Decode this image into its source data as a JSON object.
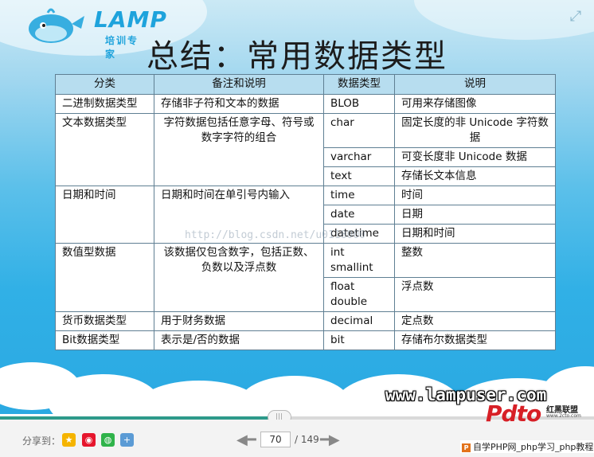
{
  "logo": {
    "word": "LAMP",
    "tagline": "培训专家"
  },
  "title": "总结：常用数据类型",
  "table": {
    "headers": [
      "分类",
      "备注和说明",
      "数据类型",
      "说明"
    ],
    "groups": [
      {
        "category": "二进制数据类型",
        "note": "存储非子符和文本的数据",
        "rows": [
          {
            "type": "BLOB",
            "desc": "可用来存储图像"
          }
        ]
      },
      {
        "category": "文本数据类型",
        "note": "字符数据包括任意字母、符号或数字字符的组合",
        "rows": [
          {
            "type": "char",
            "desc": "固定长度的非 Unicode 字符数据"
          },
          {
            "type": "varchar",
            "desc": "可变长度非 Unicode 数据"
          },
          {
            "type": "text",
            "desc": "存储长文本信息"
          }
        ]
      },
      {
        "category": "日期和时间",
        "note": "日期和时间在单引号内输入",
        "rows": [
          {
            "type": "time",
            "desc": "时间"
          },
          {
            "type": "date",
            "desc": "日期"
          },
          {
            "type": "datetime",
            "desc": "日期和时间"
          }
        ]
      },
      {
        "category": "数值型数据",
        "note": "该数据仅包含数字，包括正数、负数以及浮点数",
        "rows": [
          {
            "type": "int smallint",
            "desc": "整数"
          },
          {
            "type": "float double",
            "desc": "浮点数"
          }
        ]
      },
      {
        "category": "货币数据类型",
        "note": "用于财务数据",
        "rows": [
          {
            "type": "decimal",
            "desc": "定点数"
          }
        ]
      },
      {
        "category": "Bit数据类型",
        "note": "表示是/否的数据",
        "rows": [
          {
            "type": "bit",
            "desc": "存储布尔数据类型"
          }
        ]
      }
    ]
  },
  "watermark": "http://blog.csdn.net/u0118000",
  "site_text": "www.lampuser.com",
  "viewer": {
    "progress": 0.47,
    "share_label": "分享到：",
    "share_icons": [
      "qzone-icon",
      "weibo-icon",
      "wechat-icon",
      "plus-icon"
    ],
    "current_page": "70",
    "total_pages": "/ 149"
  },
  "brand": {
    "logo": "Pdto",
    "name": "红黑联盟",
    "sub": "www.2cto.com",
    "text": "自学PHP网_php学习_php教程"
  },
  "colors": {
    "slide_blue": "#2aa9e2",
    "header_bg": "#b7ddef",
    "progress": "#2d9a8a",
    "brand_red": "#d71f26"
  }
}
